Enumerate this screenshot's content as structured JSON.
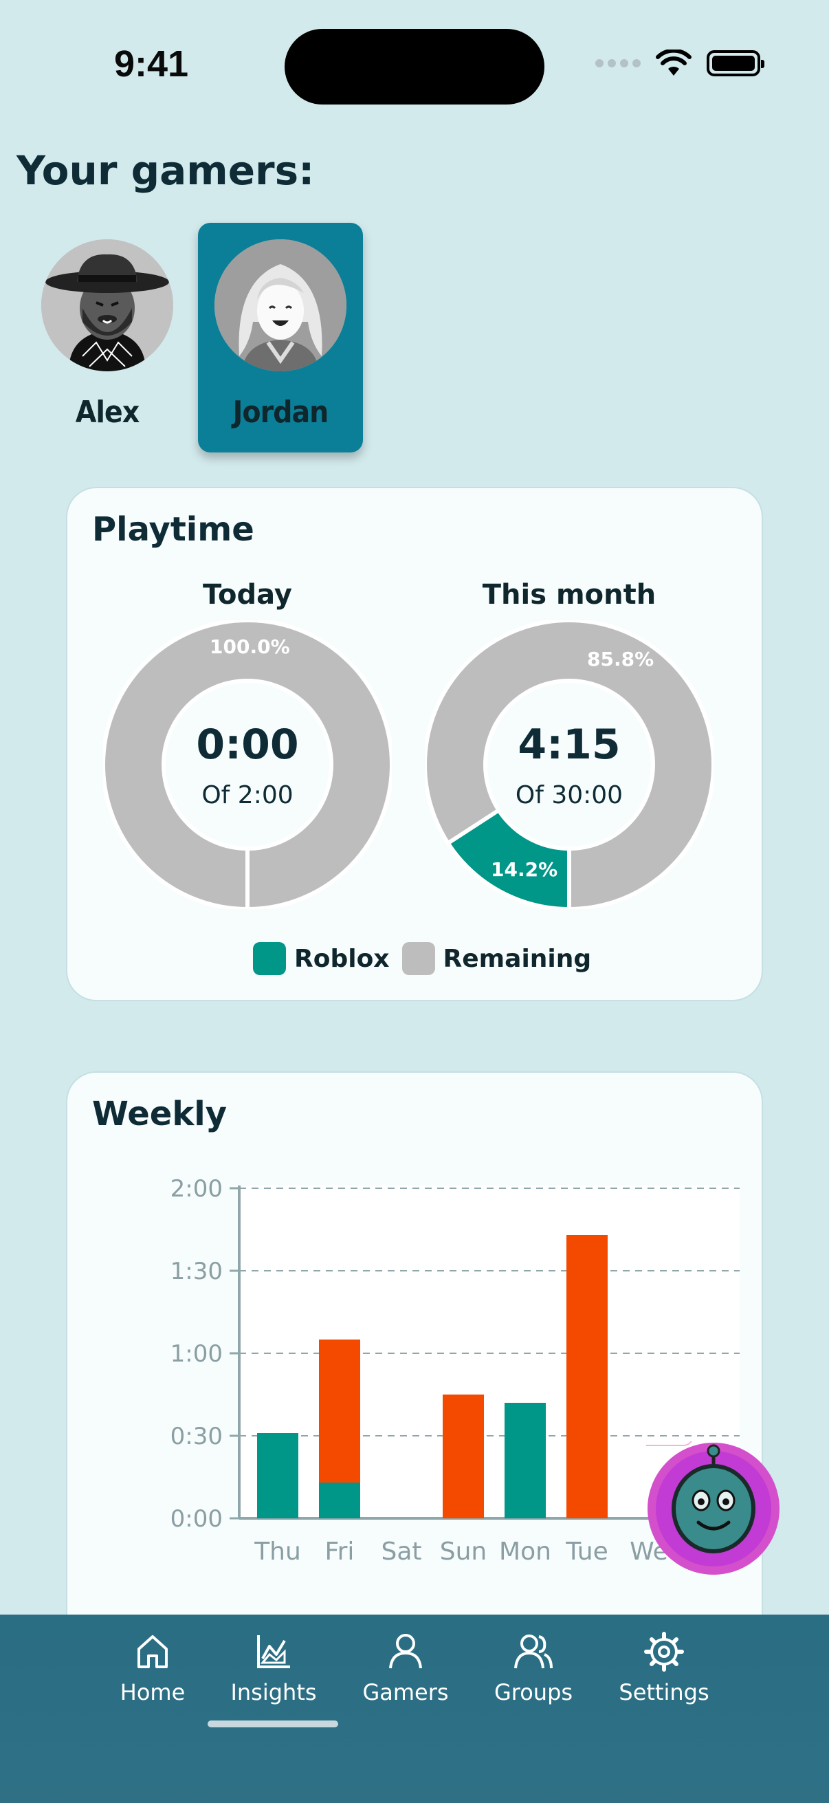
{
  "status_bar": {
    "time": "9:41"
  },
  "heading": "Your gamers:",
  "gamers": [
    {
      "name": "Alex",
      "selected": false
    },
    {
      "name": "Jordan",
      "selected": true
    }
  ],
  "playtime": {
    "title": "Playtime",
    "today": {
      "label": "Today",
      "value": "0:00",
      "sub": "Of 2:00",
      "remaining_pct": "100.0%"
    },
    "month": {
      "label": "This month",
      "value": "4:15",
      "sub": "Of 30:00",
      "remaining_pct": "85.8%",
      "roblox_pct": "14.2%"
    },
    "legend": [
      {
        "label": "Roblox",
        "color": "#009688"
      },
      {
        "label": "Remaining",
        "color": "#bdbdbd"
      }
    ]
  },
  "weekly": {
    "title": "Weekly"
  },
  "chart_data": [
    {
      "type": "pie",
      "title": "Today",
      "slices": [
        {
          "label": "Remaining",
          "value": 100.0,
          "color": "#bdbdbd"
        }
      ]
    },
    {
      "type": "pie",
      "title": "This month",
      "slices": [
        {
          "label": "Roblox",
          "value": 14.2,
          "color": "#009688"
        },
        {
          "label": "Remaining",
          "value": 85.8,
          "color": "#bdbdbd"
        }
      ]
    },
    {
      "type": "bar",
      "title": "Weekly",
      "categories": [
        "Thu",
        "Fri",
        "Sat",
        "Sun",
        "Mon",
        "Tue",
        "Wed"
      ],
      "y_ticks": [
        "0:00",
        "0:30",
        "1:00",
        "1:30",
        "2:00"
      ],
      "ylim_minutes": [
        0,
        120
      ],
      "series": [
        {
          "color": "#009688",
          "values": [
            31,
            13,
            0,
            0,
            42,
            0,
            0
          ]
        },
        {
          "color": "#f44a00",
          "values": [
            0,
            52,
            0,
            45,
            0,
            103,
            0
          ]
        }
      ],
      "x_tick_labels_visible": [
        "Thu",
        "Fri",
        "Sat",
        "Sun",
        "Mon",
        "Tue",
        "We"
      ]
    }
  ],
  "nav": [
    {
      "label": "Home",
      "icon": "home-icon"
    },
    {
      "label": "Insights",
      "icon": "insights-icon",
      "active": true
    },
    {
      "label": "Gamers",
      "icon": "user-icon"
    },
    {
      "label": "Groups",
      "icon": "group-icon"
    },
    {
      "label": "Settings",
      "icon": "gear-icon"
    }
  ]
}
